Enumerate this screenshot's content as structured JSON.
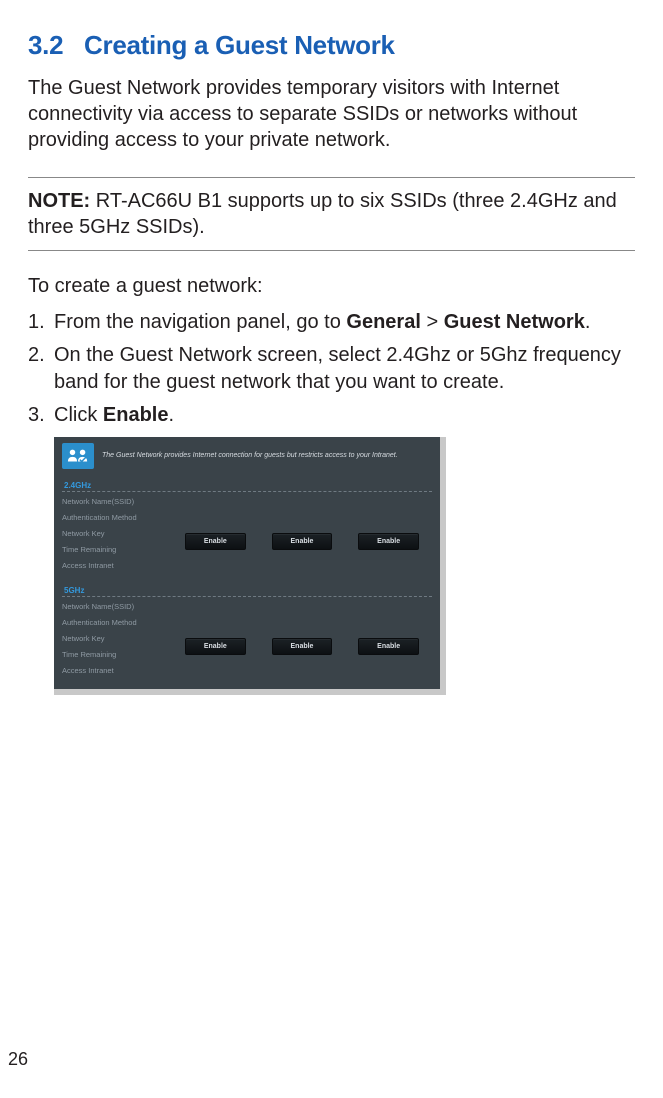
{
  "section": {
    "number": "3.2",
    "title": "Creating a Guest Network"
  },
  "intro": "The Guest Network provides temporary visitors with Internet connectivity via access to separate SSIDs or networks without providing access to your private network.",
  "note": {
    "label": "NOTE:",
    "text": " RT-AC66U B1 supports up to six SSIDs (three 2.4GHz and three 5GHz SSIDs)."
  },
  "howto": "To create a guest network:",
  "steps": {
    "s1a": "From the navigation panel, go to ",
    "s1b": "General",
    "s1c": " > ",
    "s1d": "Guest Network",
    "s1e": ".",
    "s2": "On the Guest Network screen, select 2.4Ghz or 5Ghz frequency band for the guest network that you want to create.",
    "s3a": "Click ",
    "s3b": "Enable",
    "s3c": "."
  },
  "screenshot": {
    "desc": "The Guest Network provides Internet connection for guests but restricts access to your Intranet.",
    "band24": "2.4GHz",
    "band5": "5GHz",
    "labels": {
      "ssid": "Network Name(SSID)",
      "auth": "Authentication Method",
      "key": "Network Key",
      "time": "Time Remaining",
      "access": "Access Intranet"
    },
    "btn": "Enable"
  },
  "page_number": "26"
}
